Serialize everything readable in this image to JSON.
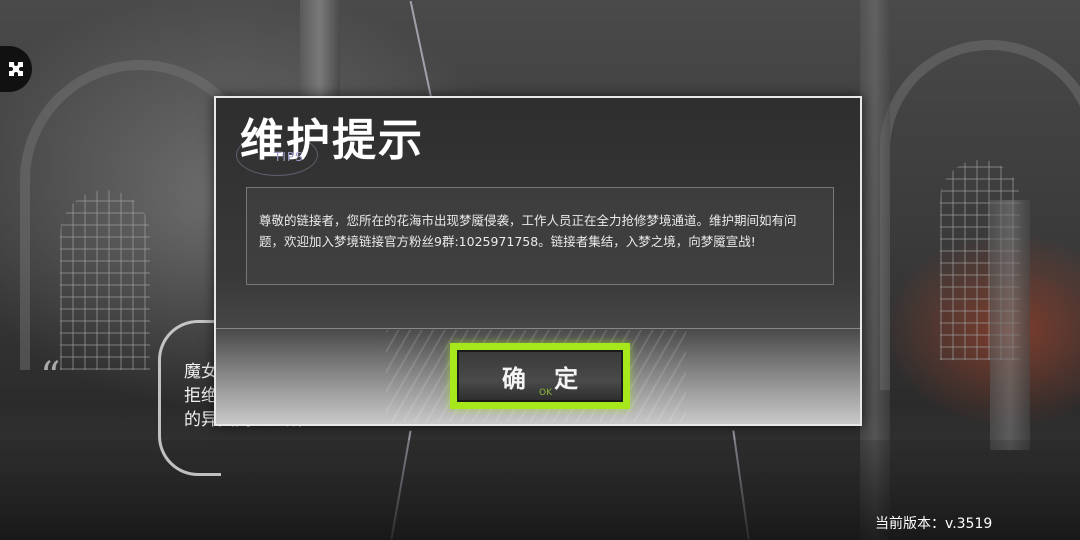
{
  "dialog": {
    "title": "维护提示",
    "tips_label": "TIPS",
    "message": "尊敬的链接者，您所在的花海市出现梦魇侵袭，工作人员正在全力抢修梦境通道。维护期间如有问题，欢迎加入梦境链接官方粉丝9群:1025971758。链接者集结，入梦之境，向梦魇宣战!",
    "confirm_label": "确 定",
    "confirm_sub": "OK"
  },
  "background": {
    "quote_mark": "“",
    "intro_text": "魔女\n拒绝\n的异类同盟之所"
  },
  "footer": {
    "version": "当前版本：v.3519"
  },
  "colors": {
    "accent": "#a6e81c",
    "dialog_border": "#e8e8e8"
  },
  "icons": {
    "top_left": "puzzle-icon"
  }
}
